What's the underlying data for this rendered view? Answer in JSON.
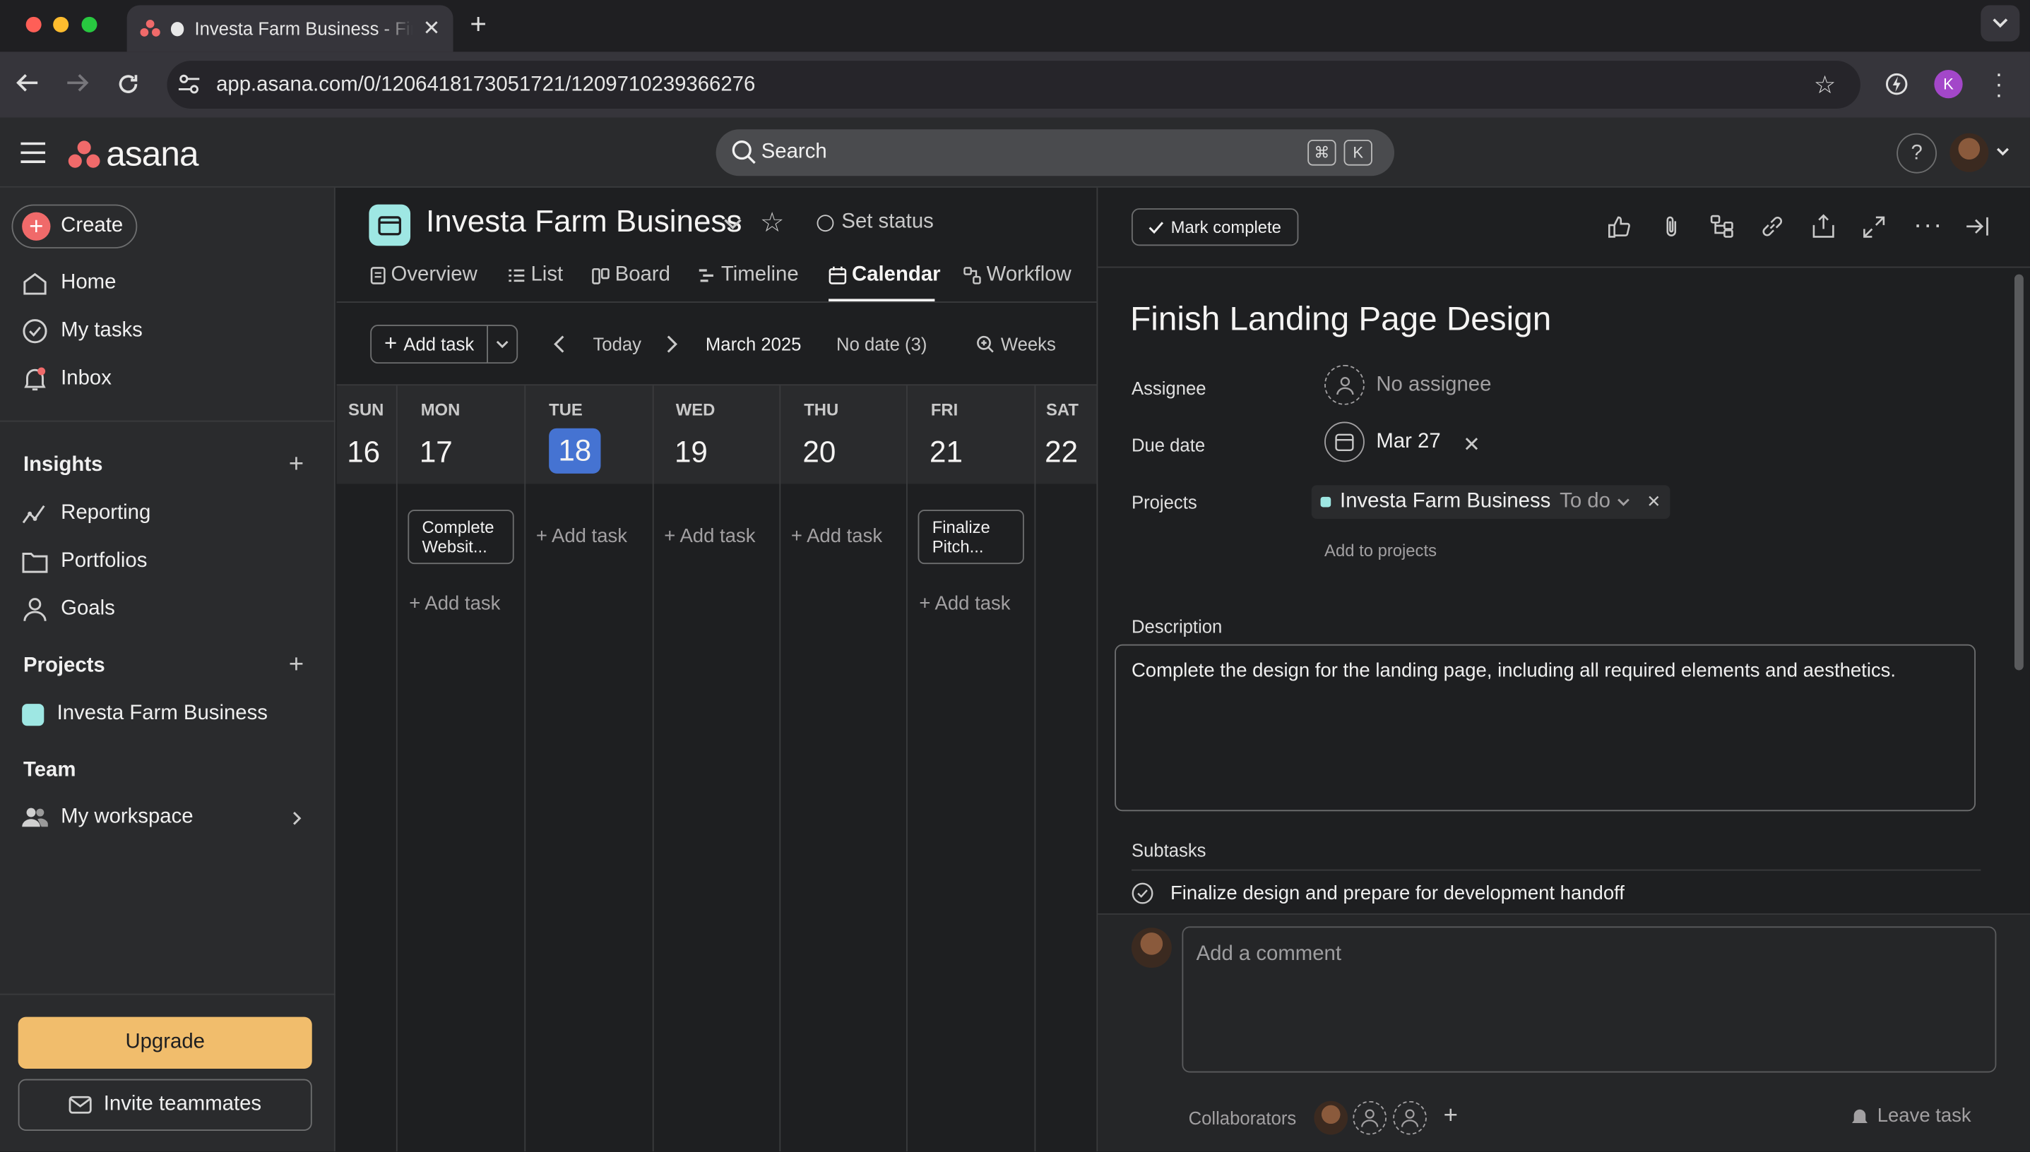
{
  "browser": {
    "tab_title": "Investa Farm Business - Fir",
    "url": "app.asana.com/0/1206418173051721/1209710239366276",
    "profile_initial": "K"
  },
  "app": {
    "logo_text": "asana",
    "search_placeholder": "Search",
    "shortcut_keys": [
      "⌘",
      "K"
    ]
  },
  "sidebar": {
    "create_label": "Create",
    "nav": [
      "Home",
      "My tasks",
      "Inbox"
    ],
    "insights_heading": "Insights",
    "insights": [
      "Reporting",
      "Portfolios",
      "Goals"
    ],
    "projects_heading": "Projects",
    "project_name": "Investa Farm Business",
    "team_heading": "Team",
    "team_item": "My workspace",
    "upgrade_label": "Upgrade",
    "invite_label": "Invite teammates"
  },
  "project": {
    "title": "Investa Farm Business",
    "set_status": "Set status",
    "tabs": [
      "Overview",
      "List",
      "Board",
      "Timeline",
      "Calendar",
      "Workflow"
    ],
    "active_tab": "Calendar",
    "toolbar": {
      "add_task": "Add task",
      "today": "Today",
      "month": "March 2025",
      "no_date": "No date (3)",
      "weeks": "Weeks"
    },
    "calendar": {
      "days": [
        {
          "name": "SUN",
          "num": "16"
        },
        {
          "name": "MON",
          "num": "17"
        },
        {
          "name": "TUE",
          "num": "18"
        },
        {
          "name": "WED",
          "num": "19"
        },
        {
          "name": "THU",
          "num": "20"
        },
        {
          "name": "FRI",
          "num": "21"
        },
        {
          "name": "SAT",
          "num": "22"
        }
      ],
      "add_task_label": "+ Add task",
      "task_mon": "Complete Websit...",
      "task_fri": "Finalize Pitch..."
    }
  },
  "task": {
    "mark_complete": "Mark complete",
    "title": "Finish Landing Page Design",
    "assignee_label": "Assignee",
    "assignee_value": "No assignee",
    "due_label": "Due date",
    "due_value": "Mar 27",
    "projects_label": "Projects",
    "project_name": "Investa Farm Business",
    "project_section": "To do",
    "add_to_projects": "Add to projects",
    "description_label": "Description",
    "description": "Complete the design for the landing page, including all required elements and aesthetics.",
    "subtasks_label": "Subtasks",
    "subtask": "Finalize design and prepare for development handoff",
    "comment_placeholder": "Add a comment",
    "collaborators_label": "Collaborators",
    "leave_task": "Leave task"
  },
  "colors": {
    "accent_blue": "#4573d2",
    "upgrade": "#f1bd6c",
    "project_color": "#9ee7e3",
    "create_red": "#f06a6a"
  }
}
